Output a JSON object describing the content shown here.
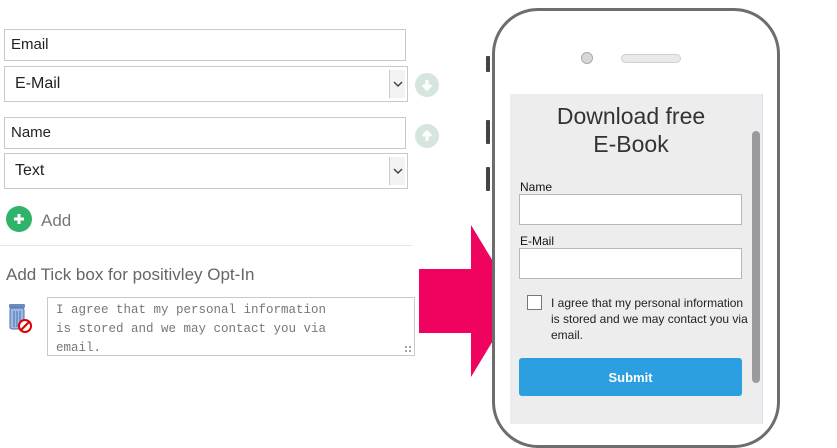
{
  "editor": {
    "fields": [
      {
        "label_value": "Email",
        "type_value": "E-Mail"
      },
      {
        "label_value": "Name",
        "type_value": "Text"
      }
    ],
    "add_label": "Add",
    "optin_title": "Add Tick box for positivley Opt-In",
    "optin_text": "I agree that my personal information\nis stored and we may contact you via\nemail."
  },
  "preview": {
    "title_line1": "Download free",
    "title_line2": "E-Book",
    "name_label": "Name",
    "email_label": "E-Mail",
    "consent_text": "I agree that my personal information is stored and we may contact you via email.",
    "submit_label": "Submit"
  },
  "colors": {
    "accent": "#2b9fe0",
    "arrow": "#f0035f",
    "add": "#2fb36a"
  },
  "icons": {
    "move_down": "arrow-down-circle",
    "move_up": "arrow-up-circle",
    "add": "plus-circle",
    "delete": "trash-icon"
  }
}
